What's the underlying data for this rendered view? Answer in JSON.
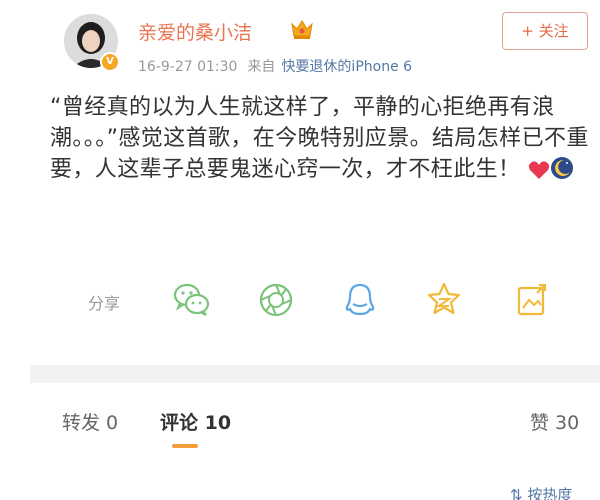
{
  "header": {
    "username": "亲爱的桑小洁",
    "timestamp": "16-9-27 01:30",
    "from_label": "来自",
    "source": "快要退休的iPhone 6",
    "follow_label": "+ 关注",
    "vip_icon": "crown-vip-icon",
    "verified_badge": "V"
  },
  "post": {
    "text": "“曾经真的以为人生就这样了，平静的心拒绝再有浪潮。。。”感觉这首歌，在今晚特别应景。结局怎样已不重要，人这辈子总要鬼迷心窍一次，才不枉此生！",
    "emojis": [
      "heart-icon",
      "moon-icon"
    ]
  },
  "share": {
    "label": "分享",
    "icons": [
      "wechat-icon",
      "moments-icon",
      "qq-icon",
      "qzone-icon",
      "image-share-icon"
    ]
  },
  "tabs": [
    {
      "label": "转发 0"
    },
    {
      "label": "评论 10"
    },
    {
      "label": "赞 30"
    }
  ],
  "sort": {
    "label": "按热度"
  },
  "colors": {
    "accent": "#eb7350",
    "link": "#5477a4",
    "green_icon": "#7ac37a",
    "blue_icon": "#5aa6e8",
    "gold_icon": "#f0b93a",
    "active_underline": "#f29d38"
  }
}
